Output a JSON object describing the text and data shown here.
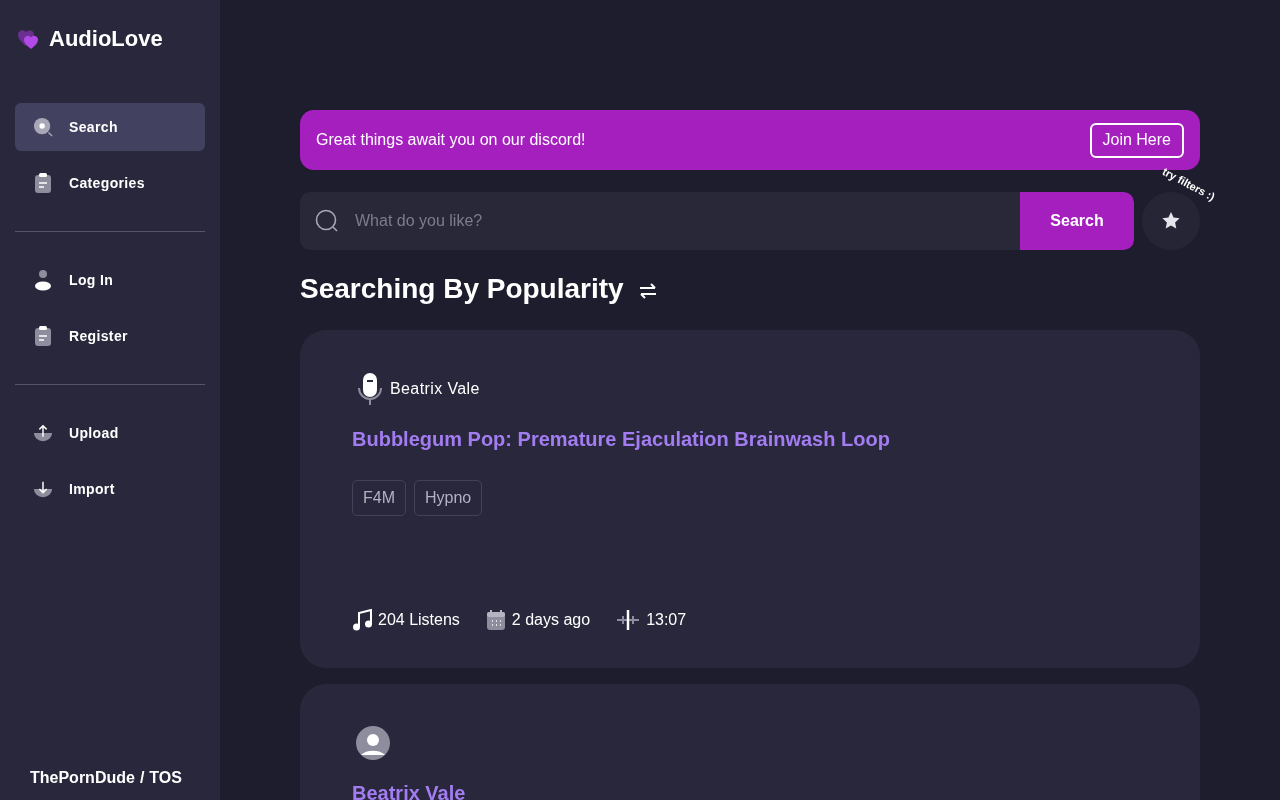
{
  "brand": {
    "name": "AudioLove"
  },
  "sidebar": {
    "sections": [
      [
        {
          "label": "Search",
          "selected": true
        },
        {
          "label": "Categories",
          "selected": false
        }
      ],
      [
        {
          "label": "Log In",
          "selected": false
        },
        {
          "label": "Register",
          "selected": false
        }
      ],
      [
        {
          "label": "Upload",
          "selected": false
        },
        {
          "label": "Import",
          "selected": false
        }
      ]
    ],
    "footer": {
      "links": [
        "ThePornDude",
        "TOS"
      ],
      "separator": "/"
    }
  },
  "banner": {
    "text": "Great things await you on our discord!",
    "button": "Join Here"
  },
  "search": {
    "placeholder": "What do you like?",
    "button": "Search",
    "filter_hint": "try filters :)"
  },
  "heading": "Searching By Popularity",
  "cards": [
    {
      "author": "Beatrix Vale",
      "title": "Bubblegum Pop: Premature Ejaculation Brainwash Loop",
      "tags": [
        "F4M",
        "Hypno"
      ],
      "listens": "204 Listens",
      "date": "2 days ago",
      "duration": "13:07"
    },
    {
      "title": "Beatrix Vale"
    }
  ]
}
